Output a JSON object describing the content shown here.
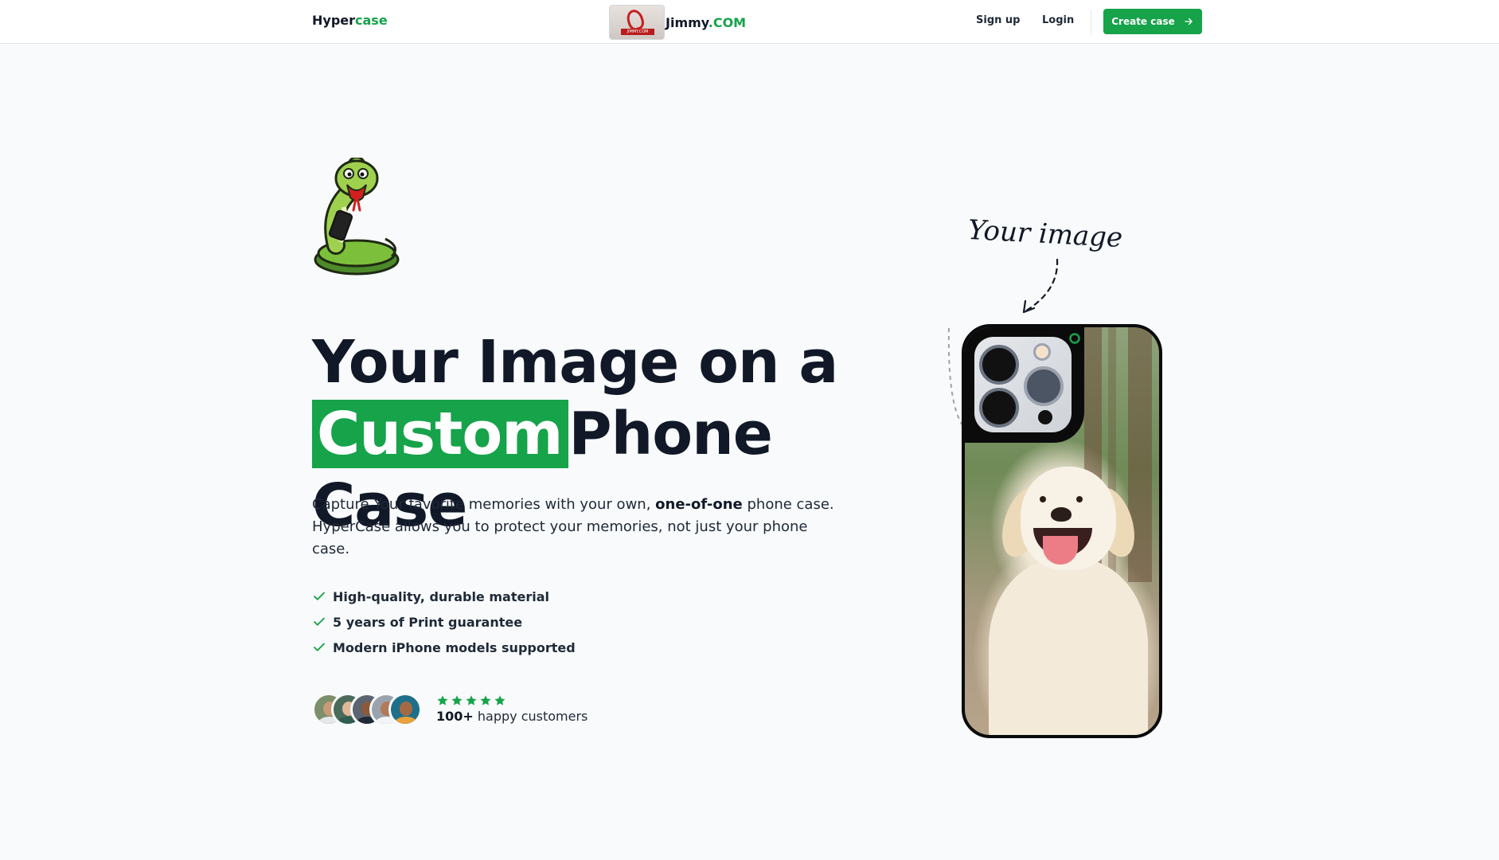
{
  "nav": {
    "brand_main": "Hyper",
    "brand_accent": "case",
    "center_name": "Jimmy",
    "center_accent": ".COM",
    "signup": "Sign up",
    "login": "Login",
    "cta": "Create case"
  },
  "hero": {
    "headline_line1": "Your Image on a",
    "headline_highlight": "Custom",
    "headline_rest": "Phone Case",
    "desc_part1": "Capture Your favorite memories with your own, ",
    "desc_bold": "one-of-one",
    "desc_part2": " phone case. HyperCase allows you to protect your memories, not just your phone case.",
    "features": [
      "High-quality, durable material",
      "5 years of Print guarantee",
      "Modern iPhone models supported"
    ],
    "rating_count": "100+",
    "rating_text": " happy customers",
    "stars": 5
  },
  "showcase": {
    "annotation": "Your image"
  },
  "colors": {
    "accent": "#16a34a",
    "text": "#111827",
    "background": "#f8fafb"
  }
}
